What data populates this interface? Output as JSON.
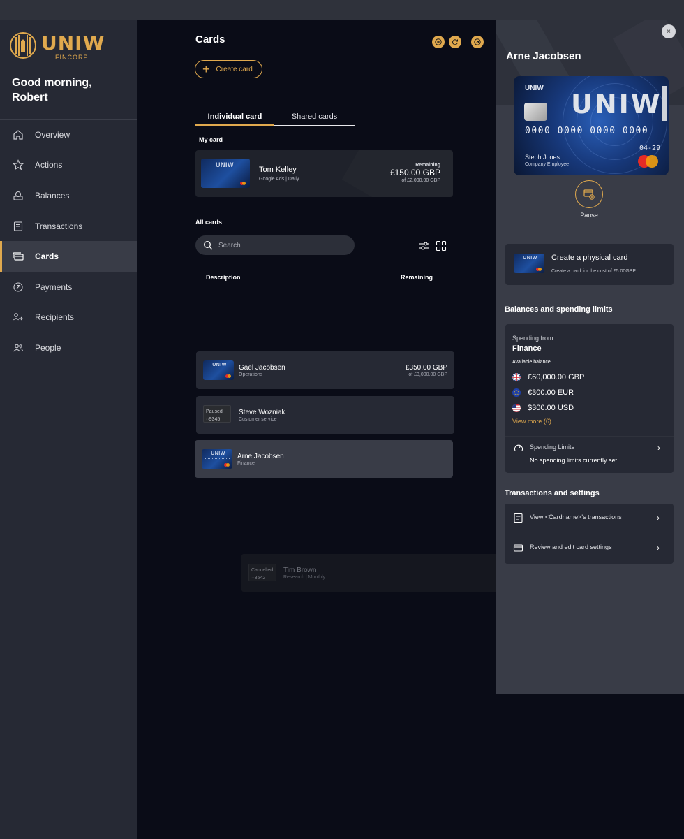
{
  "brand": {
    "name": "UNIW",
    "sub": "FINCORP",
    "accent": "#e0a94e"
  },
  "greeting": "Good morning, Robert",
  "nav": [
    {
      "label": "Overview",
      "icon": "home-icon"
    },
    {
      "label": "Actions",
      "icon": "star-icon"
    },
    {
      "label": "Balances",
      "icon": "coins-icon"
    },
    {
      "label": "Transactions",
      "icon": "document-icon"
    },
    {
      "label": "Cards",
      "icon": "cards-icon",
      "active": true
    },
    {
      "label": "Payments",
      "icon": "send-icon"
    },
    {
      "label": "Recipients",
      "icon": "recipients-icon"
    },
    {
      "label": "People",
      "icon": "people-icon"
    }
  ],
  "main": {
    "title": "Cards",
    "create_label": "Create card",
    "tabs": [
      "Individual card",
      "Shared cards"
    ],
    "my_card_label": "My card",
    "my_card": {
      "name": "Tom Kelley",
      "sub": "Google Ads | Daily",
      "remaining_label": "Remaining",
      "remaining": "£150.00 GBP",
      "of": "of £2,000.00 GBP"
    },
    "all_cards_label": "All cards",
    "search_placeholder": "Search",
    "columns": [
      "Description",
      "Remaining"
    ],
    "rows": [
      {
        "name": "Gael Jacobsen",
        "sub": "Operations",
        "amount": "£350.00 GBP",
        "of": "of £3,000.00 GBP"
      },
      {
        "name": "Steve Wozniak",
        "sub": "Customer service",
        "status": "Paused",
        "last4": "··9345"
      },
      {
        "name": "Arne Jacobsen",
        "sub": "Finance"
      }
    ],
    "ghost_row": {
      "name": "Tim Brown",
      "sub": "Research | Monthly",
      "status": "Cancelled",
      "last4": "··3542"
    }
  },
  "panel": {
    "close": "×",
    "title": "Arne Jacobsen",
    "card": {
      "small_logo": "UNIW",
      "logo": "UNIW",
      "number": "0000 0000 0000 0000",
      "expiry": "04-29",
      "holder": "Steph Jones",
      "holder_role": "Company Employee"
    },
    "pause_label": "Pause",
    "physical": {
      "title": "Create a physical card",
      "sub": "Create a card for the cost of £5.00GBP"
    },
    "balances_heading": "Balances and spending limits",
    "spending_from_label": "Spending from",
    "spending_from": "Finance",
    "available_label": "Available balance",
    "balances": [
      {
        "amount": "£60,000.00 GBP",
        "flag": "uk-flag-icon"
      },
      {
        "amount": "€300.00 EUR",
        "flag": "eu-flag-icon"
      },
      {
        "amount": "$300.00 USD",
        "flag": "us-flag-icon"
      }
    ],
    "view_more": "View more (6)",
    "limits_label": "Spending Limits",
    "limits_text": "No spending limits currently set.",
    "tx_heading": "Transactions and settings",
    "tx_items": [
      "View <Cardname>'s transactions",
      "Review and edit card settings"
    ]
  }
}
